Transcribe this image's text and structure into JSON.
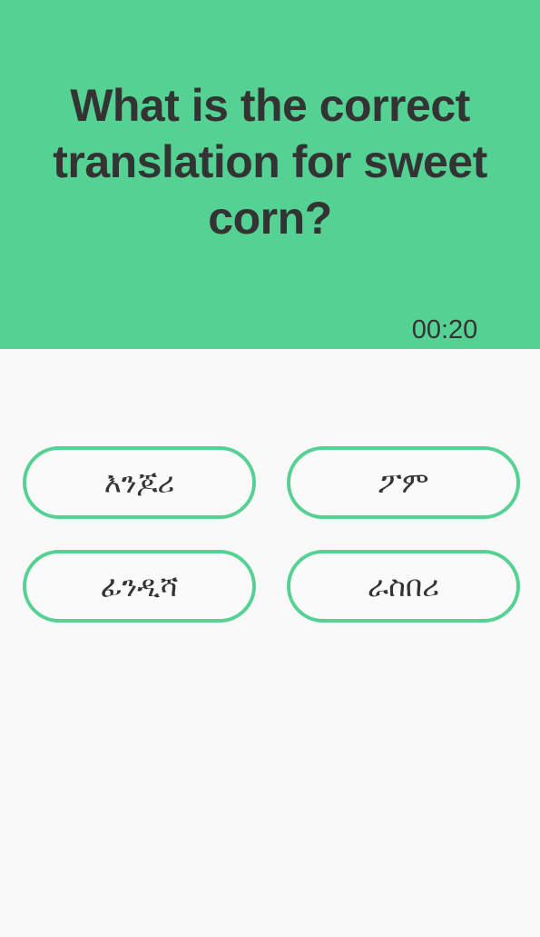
{
  "quiz": {
    "question": "What is the correct translation for sweet corn?",
    "timer": "00:20",
    "answers": [
      {
        "label": "እንጆሪ"
      },
      {
        "label": "ፖም"
      },
      {
        "label": "ፊንዲሻ"
      },
      {
        "label": "ራስበሪ"
      }
    ]
  },
  "colors": {
    "accent": "#55d293",
    "text": "#333333",
    "background": "#f9f9f9"
  }
}
